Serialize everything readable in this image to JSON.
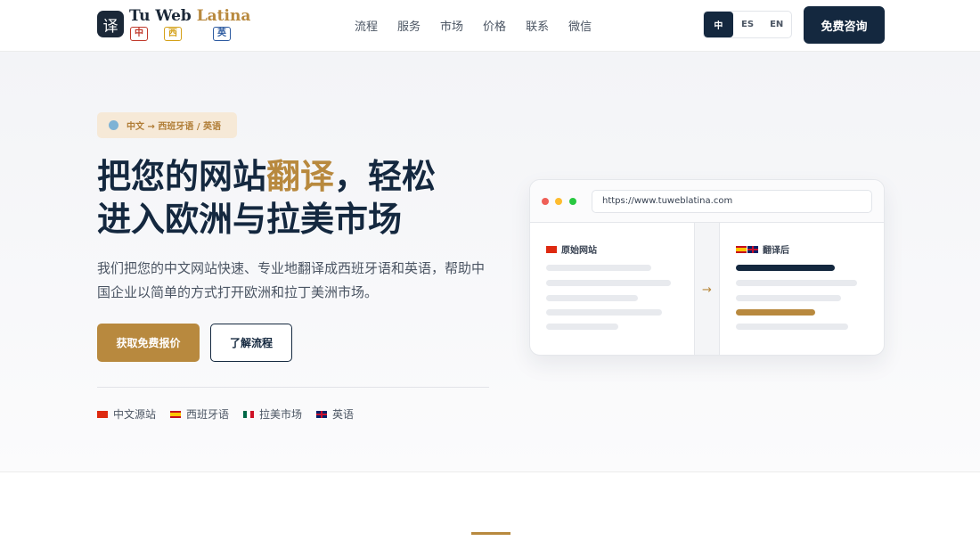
{
  "header": {
    "logo_mark": "译",
    "logo_title_part1": "Tu Web ",
    "logo_title_part2": "Latina",
    "logo_chips": [
      "中",
      "西",
      "英"
    ],
    "nav": [
      "流程",
      "服务",
      "市场",
      "价格",
      "联系",
      "微信"
    ],
    "languages": [
      "中",
      "ES",
      "EN"
    ],
    "active_language": "中",
    "cta_label": "免费咨询"
  },
  "hero": {
    "badge": "中文 → 西班牙语 / 英语",
    "title_part1": "把您的网站",
    "title_highlight": "翻译",
    "title_part2": "，轻松",
    "title_line2": "进入欧洲与拉美市场",
    "subtitle": "我们把您的中文网站快速、专业地翻译成西班牙语和英语，帮助中国企业以简单的方式打开欧洲和拉丁美洲市场。",
    "primary_button": "获取免费报价",
    "secondary_button": "了解流程",
    "tags": [
      "中文源站",
      "西班牙语",
      "拉美市场",
      "英语"
    ]
  },
  "browser_mock": {
    "url": "https://www.tuweblatina.com",
    "left_label": "原始网站",
    "right_label": "翻译后",
    "arrow": "→"
  },
  "colors": {
    "navy": "#14283f",
    "gold": "#b8893e",
    "badge_bg": "#f6e9d7"
  }
}
